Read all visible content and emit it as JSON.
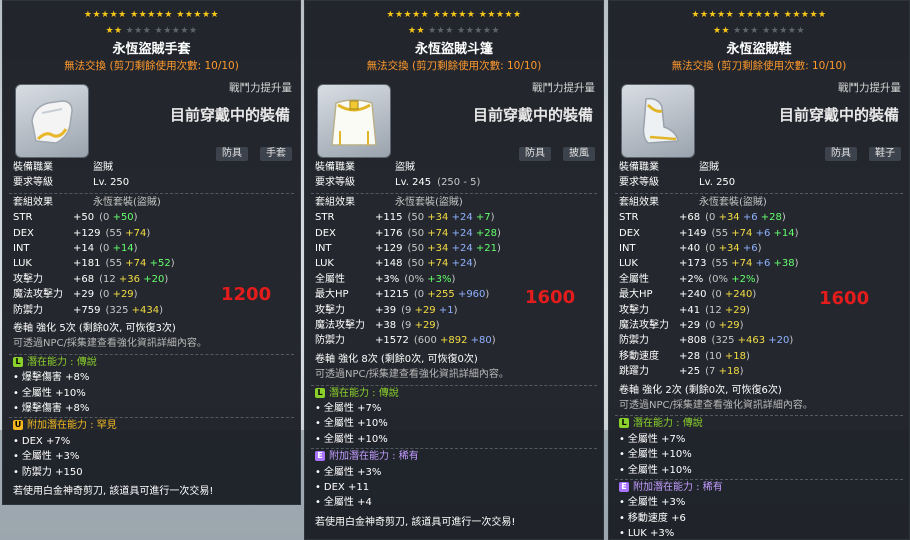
{
  "tooltips": [
    {
      "id": "gloves",
      "stars_row1": "★★★★★  ★★★★★  ★★★★★",
      "stars_row2_on": "★★",
      "stars_row2_off": "★★★  ★★★★★",
      "title": "永恆盜賊手套",
      "trade_text": "無法交換 (剪刀剩餘使用次數: 10/10)",
      "cp_label": "戰鬥力提升量",
      "equipped_text": "目前穿戴中的裝備",
      "tags": [
        "防具",
        "手套"
      ],
      "job_label": "裝備職業",
      "job_value": "盜賊",
      "level_label": "要求等級",
      "level_value": "Lv. 250",
      "level_extra": "",
      "set_label": "套組效果",
      "set_value": "永恆套裝(盜賊)",
      "stats": [
        {
          "name": "STR",
          "base": "+50",
          "detail": "(0 ",
          "parts": [
            {
              "t": "+50",
              "c": "g"
            }
          ],
          "close": ")"
        },
        {
          "name": "DEX",
          "base": "+129",
          "detail": "(55 ",
          "parts": [
            {
              "t": "+74",
              "c": "y"
            }
          ],
          "close": ")"
        },
        {
          "name": "INT",
          "base": "+14",
          "detail": "(0 ",
          "parts": [
            {
              "t": "+14",
              "c": "g"
            }
          ],
          "close": ")"
        },
        {
          "name": "LUK",
          "base": "+181",
          "detail": "(55 ",
          "parts": [
            {
              "t": "+74 ",
              "c": "y"
            },
            {
              "t": "+52",
              "c": "g"
            }
          ],
          "close": ")"
        },
        {
          "name": "攻擊力",
          "base": "+68",
          "detail": "(12 ",
          "parts": [
            {
              "t": "+36 ",
              "c": "y"
            },
            {
              "t": "+20",
              "c": "g"
            }
          ],
          "close": ")"
        },
        {
          "name": "魔法攻擊力",
          "base": "+29",
          "detail": "(0 ",
          "parts": [
            {
              "t": "+29",
              "c": "y"
            }
          ],
          "close": ")"
        },
        {
          "name": "防禦力",
          "base": "+759",
          "detail": "(325 ",
          "parts": [
            {
              "t": "+434",
              "c": "y"
            }
          ],
          "close": ")"
        }
      ],
      "big_number": "1200",
      "scroll_text": "卷軸 強化 5次 (剩餘0次, 可恢復3次)",
      "info_text": "可透過NPC/採集建查看強化資訊詳細內容。",
      "potential_label": "潛在能力 : 傳說",
      "potential_grade": "L",
      "potential_lines": [
        "爆擊傷害 +8%",
        "全屬性 +10%",
        "爆擊傷害 +8%"
      ],
      "add_potential_label": "附加潛在能力 : 罕見",
      "add_potential_grade": "U",
      "add_potential_lines": [
        "DEX +7%",
        "全屬性 +3%",
        "防禦力 +150"
      ],
      "footer_text": "若使用白金神奇剪刀, 該道具可進行一次交易!"
    },
    {
      "id": "cape",
      "stars_row1": "★★★★★  ★★★★★  ★★★★★",
      "stars_row2_on": "★★",
      "stars_row2_off": "★★★  ★★★★★",
      "title": "永恆盜賊斗篷",
      "trade_text": "無法交換 (剪刀剩餘使用次數: 10/10)",
      "cp_label": "戰鬥力提升量",
      "equipped_text": "目前穿戴中的裝備",
      "tags": [
        "防具",
        "披風"
      ],
      "job_label": "裝備職業",
      "job_value": "盜賊",
      "level_label": "要求等級",
      "level_value": "Lv. 245",
      "level_extra": "(250 - 5)",
      "set_label": "套組效果",
      "set_value": "永恆套裝(盜賊)",
      "stats": [
        {
          "name": "STR",
          "base": "+115",
          "detail": "(50 ",
          "parts": [
            {
              "t": "+34 ",
              "c": "y"
            },
            {
              "t": "+24 ",
              "c": "b"
            },
            {
              "t": "+7",
              "c": "g"
            }
          ],
          "close": ")"
        },
        {
          "name": "DEX",
          "base": "+176",
          "detail": "(50 ",
          "parts": [
            {
              "t": "+74 ",
              "c": "y"
            },
            {
              "t": "+24 ",
              "c": "b"
            },
            {
              "t": "+28",
              "c": "g"
            }
          ],
          "close": ")"
        },
        {
          "name": "INT",
          "base": "+129",
          "detail": "(50 ",
          "parts": [
            {
              "t": "+34 ",
              "c": "y"
            },
            {
              "t": "+24 ",
              "c": "b"
            },
            {
              "t": "+21",
              "c": "g"
            }
          ],
          "close": ")"
        },
        {
          "name": "LUK",
          "base": "+148",
          "detail": "(50 ",
          "parts": [
            {
              "t": "+74 ",
              "c": "y"
            },
            {
              "t": "+24",
              "c": "b"
            }
          ],
          "close": ")"
        },
        {
          "name": "全屬性",
          "base": "+3%",
          "detail": "(0% ",
          "parts": [
            {
              "t": "+3%",
              "c": "g"
            }
          ],
          "close": ")"
        },
        {
          "name": "最大HP",
          "base": "+1215",
          "detail": "(0 ",
          "parts": [
            {
              "t": "+255 ",
              "c": "y"
            },
            {
              "t": "+960",
              "c": "b"
            }
          ],
          "close": ")"
        },
        {
          "name": "攻擊力",
          "base": "+39",
          "detail": "(9 ",
          "parts": [
            {
              "t": "+29 ",
              "c": "y"
            },
            {
              "t": "+1",
              "c": "b"
            }
          ],
          "close": ")"
        },
        {
          "name": "魔法攻擊力",
          "base": "+38",
          "detail": "(9 ",
          "parts": [
            {
              "t": "+29",
              "c": "y"
            }
          ],
          "close": ")"
        },
        {
          "name": "防禦力",
          "base": "+1572",
          "detail": "(600 ",
          "parts": [
            {
              "t": "+892 ",
              "c": "y"
            },
            {
              "t": "+80",
              "c": "b"
            }
          ],
          "close": ")"
        }
      ],
      "big_number": "1600",
      "scroll_text": "卷軸 強化 8次 (剩餘0次, 可恢復0次)",
      "info_text": "可透過NPC/採集建查看強化資訊詳細內容。",
      "potential_label": "潛在能力 : 傳說",
      "potential_grade": "L",
      "potential_lines": [
        "全屬性 +7%",
        "全屬性 +10%",
        "全屬性 +10%"
      ],
      "add_potential_label": "附加潛在能力 : 稀有",
      "add_potential_grade": "E",
      "add_potential_lines": [
        "全屬性 +3%",
        "DEX +11",
        "全屬性 +4"
      ],
      "footer_text": "若使用白金神奇剪刀, 該道具可進行一次交易!"
    },
    {
      "id": "shoes",
      "stars_row1": "★★★★★  ★★★★★  ★★★★★",
      "stars_row2_on": "★★",
      "stars_row2_off": "★★★  ★★★★★",
      "title": "永恆盜賊鞋",
      "trade_text": "無法交換 (剪刀剩餘使用次數: 10/10)",
      "cp_label": "戰鬥力提升量",
      "equipped_text": "目前穿戴中的裝備",
      "tags": [
        "防具",
        "鞋子"
      ],
      "job_label": "裝備職業",
      "job_value": "盜賊",
      "level_label": "要求等級",
      "level_value": "Lv. 250",
      "level_extra": "",
      "set_label": "套組效果",
      "set_value": "永恆套裝(盜賊)",
      "stats": [
        {
          "name": "STR",
          "base": "+68",
          "detail": "(0 ",
          "parts": [
            {
              "t": "+34 ",
              "c": "y"
            },
            {
              "t": "+6 ",
              "c": "b"
            },
            {
              "t": "+28",
              "c": "g"
            }
          ],
          "close": ")"
        },
        {
          "name": "DEX",
          "base": "+149",
          "detail": "(55 ",
          "parts": [
            {
              "t": "+74 ",
              "c": "y"
            },
            {
              "t": "+6 ",
              "c": "b"
            },
            {
              "t": "+14",
              "c": "g"
            }
          ],
          "close": ")"
        },
        {
          "name": "INT",
          "base": "+40",
          "detail": "(0 ",
          "parts": [
            {
              "t": "+34 ",
              "c": "y"
            },
            {
              "t": "+6",
              "c": "b"
            }
          ],
          "close": ")"
        },
        {
          "name": "LUK",
          "base": "+173",
          "detail": "(55 ",
          "parts": [
            {
              "t": "+74 ",
              "c": "y"
            },
            {
              "t": "+6 ",
              "c": "b"
            },
            {
              "t": "+38",
              "c": "g"
            }
          ],
          "close": ")"
        },
        {
          "name": "全屬性",
          "base": "+2%",
          "detail": "(0% ",
          "parts": [
            {
              "t": "+2%",
              "c": "g"
            }
          ],
          "close": ")"
        },
        {
          "name": "最大HP",
          "base": "+240",
          "detail": "(0 ",
          "parts": [
            {
              "t": "+240",
              "c": "y"
            }
          ],
          "close": ")"
        },
        {
          "name": "攻擊力",
          "base": "+41",
          "detail": "(12 ",
          "parts": [
            {
              "t": "+29",
              "c": "y"
            }
          ],
          "close": ")"
        },
        {
          "name": "魔法攻擊力",
          "base": "+29",
          "detail": "(0 ",
          "parts": [
            {
              "t": "+29",
              "c": "y"
            }
          ],
          "close": ")"
        },
        {
          "name": "防禦力",
          "base": "+808",
          "detail": "(325 ",
          "parts": [
            {
              "t": "+463 ",
              "c": "y"
            },
            {
              "t": "+20",
              "c": "b"
            }
          ],
          "close": ")"
        },
        {
          "name": "移動速度",
          "base": "+28",
          "detail": "(10 ",
          "parts": [
            {
              "t": "+18",
              "c": "y"
            }
          ],
          "close": ")"
        },
        {
          "name": "跳躍力",
          "base": "+25",
          "detail": "(7 ",
          "parts": [
            {
              "t": "+18",
              "c": "y"
            }
          ],
          "close": ")"
        }
      ],
      "big_number": "1600",
      "scroll_text": "卷軸 強化 2次 (剩餘0次, 可恢復6次)",
      "info_text": "可透過NPC/採集建查看強化資訊詳細內容。",
      "potential_label": "潛在能力 : 傳說",
      "potential_grade": "L",
      "potential_lines": [
        "全屬性 +7%",
        "全屬性 +10%",
        "全屬性 +10%"
      ],
      "add_potential_label": "附加潛在能力 : 稀有",
      "add_potential_grade": "E",
      "add_potential_lines": [
        "全屬性 +3%",
        "移動速度 +6",
        "LUK +3%"
      ],
      "footer_text": ""
    }
  ]
}
